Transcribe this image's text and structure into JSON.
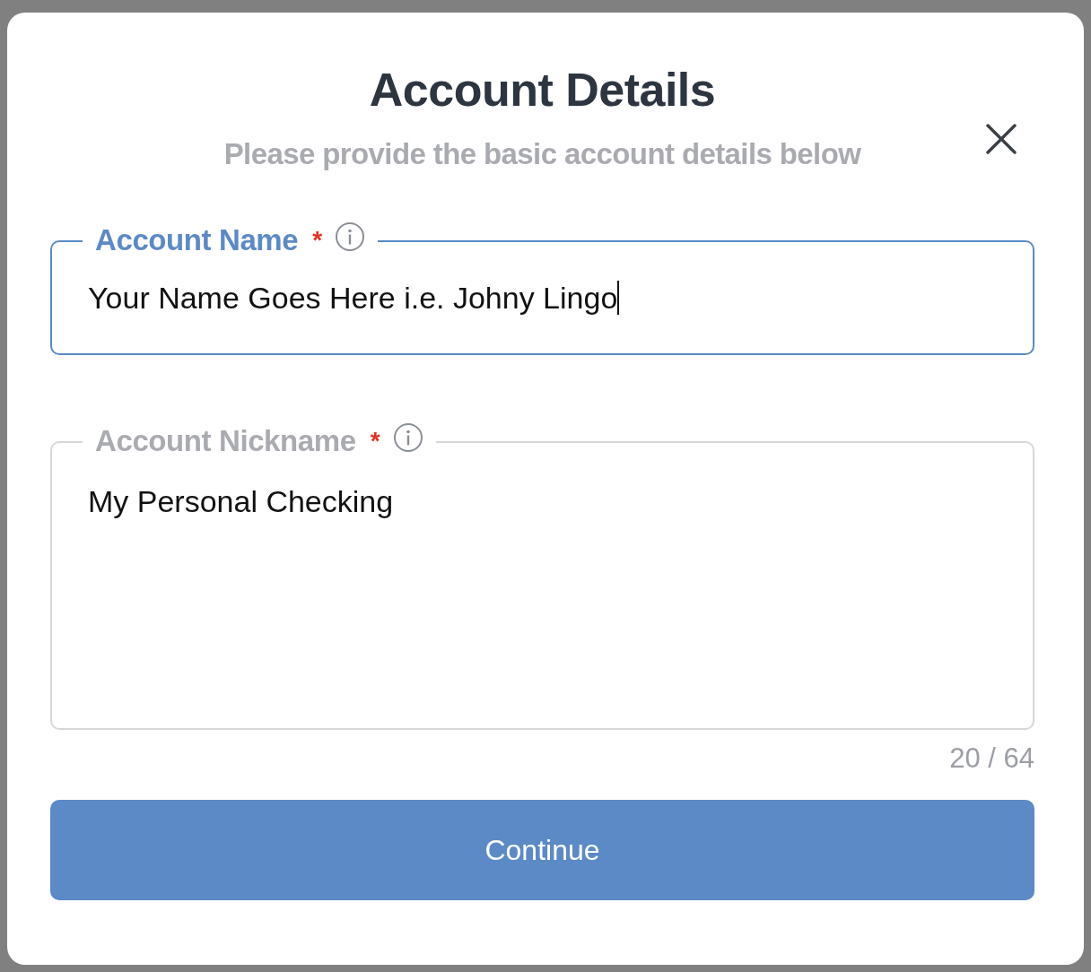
{
  "dialog": {
    "title": "Account Details",
    "subtitle": "Please provide the basic account details below"
  },
  "fields": [
    {
      "kind": "input",
      "label": "Account Name",
      "required": true,
      "required_mark": "*",
      "focused": true,
      "value": "Your Name Goes Here i.e. Johny Lingo"
    },
    {
      "kind": "textarea",
      "label": "Account Nickname",
      "required": true,
      "required_mark": "*",
      "focused": false,
      "value": "My Personal Checking",
      "counter": "20 / 64"
    }
  ],
  "button": {
    "label": "Continue"
  }
}
